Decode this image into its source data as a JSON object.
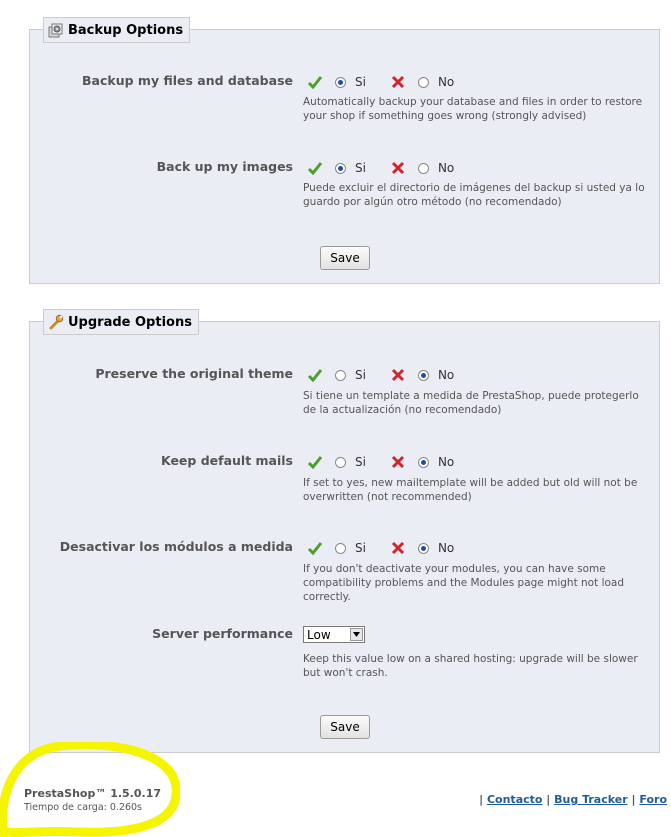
{
  "backup": {
    "title": "Backup Options",
    "files_db": {
      "label": "Backup my files and database",
      "yes_label": "Si",
      "no_label": "No",
      "selected": "yes",
      "hint": "Automatically backup your database and files in order to restore your shop if something goes wrong (strongly advised)"
    },
    "images": {
      "label": "Back up my images",
      "yes_label": "Si",
      "no_label": "No",
      "selected": "yes",
      "hint": "Puede excluir el directorio de imágenes del backup si usted ya lo guardo por algún otro método (no recomendado)"
    },
    "save_label": "Save"
  },
  "upgrade": {
    "title": "Upgrade Options",
    "theme": {
      "label": "Preserve the original theme",
      "yes_label": "Si",
      "no_label": "No",
      "selected": "no",
      "hint": "Si tiene un template a medida de PrestaShop, puede protegerlo de la actualización (no recomendado)"
    },
    "mails": {
      "label": "Keep default mails",
      "yes_label": "Si",
      "no_label": "No",
      "selected": "no",
      "hint": "If set to yes, new mailtemplate will be added but old will not be overwritten (not recommended)"
    },
    "modules": {
      "label": "Desactivar los módulos a medida",
      "yes_label": "Si",
      "no_label": "No",
      "selected": "no",
      "hint": "If you don't deactivate your modules, you can have some compatibility problems and the Modules page might not load correctly."
    },
    "performance": {
      "label": "Server performance",
      "value": "Low",
      "hint": "Keep this value low on a shared hosting: upgrade will be slower but won't crash."
    },
    "save_label": "Save"
  },
  "footer": {
    "version": "PrestaShop™ 1.5.0.17",
    "load_time": "Tiempo de carga: 0.260s",
    "links": [
      "Contacto",
      "Bug Tracker",
      "Foro"
    ],
    "separator": "|"
  },
  "colors": {
    "panel_bg": "#ebedf4",
    "highlight": "#f5f500",
    "link": "#1f5d9a",
    "check_green": "#4aa02c",
    "cross_red": "#d0252a"
  }
}
